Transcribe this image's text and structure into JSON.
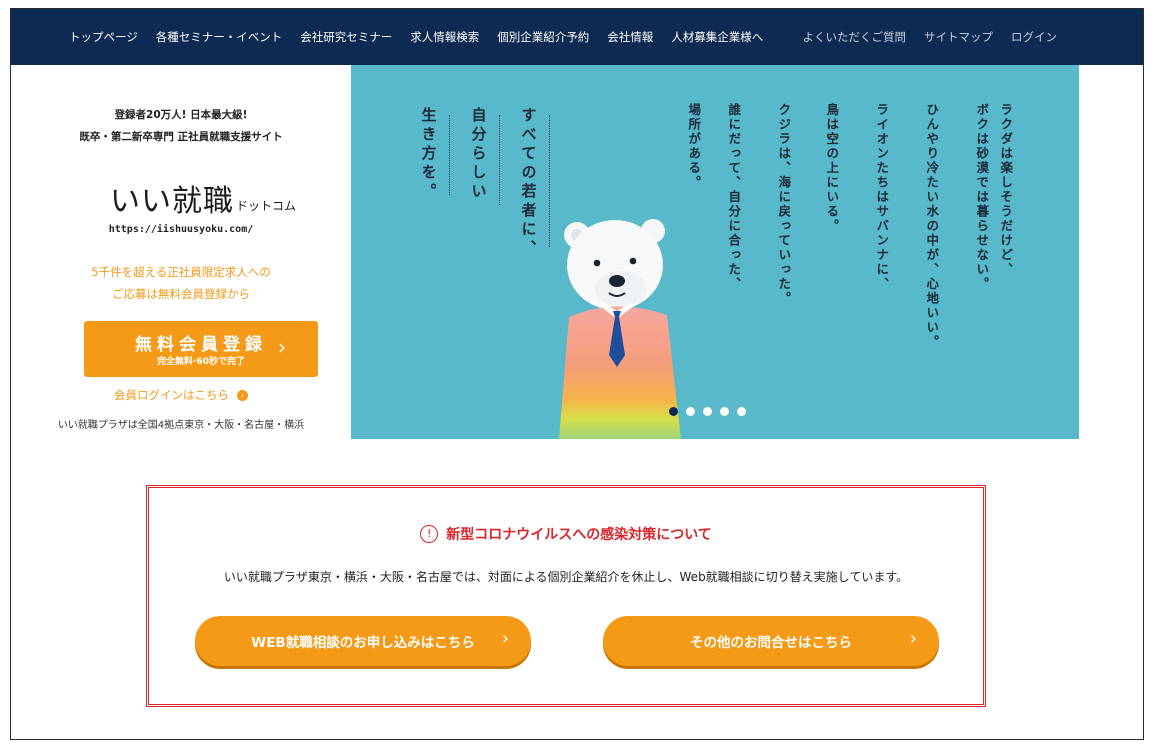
{
  "nav": {
    "left": [
      "トップページ",
      "各種セミナー・イベント",
      "会社研究セミナー",
      "求人情報検索",
      "個別企業紹介予約",
      "会社情報",
      "人材募集企業様へ"
    ],
    "right": [
      "よくいただくご質問",
      "サイトマップ",
      "ログイン"
    ]
  },
  "left": {
    "tagline1": "登録者20万人! 日本最大級!",
    "tagline2": "既卒・第二新卒専門 正社員就職支援サイト",
    "logo_main": "いい就職",
    "logo_sub": "ドットコム",
    "url": "https://iishuusyoku.com/",
    "promo1": "5千件を超える正社員限定求人への",
    "promo2": "ご応募は無料会員登録から",
    "register_main": "無料会員登録",
    "register_sub": "完全無料·60秒で完了",
    "login": "会員ログインはこちら",
    "plaza": "いい就職プラザは全国4拠点東京・大阪・名古屋・横浜"
  },
  "hero": {
    "columns": [
      "ラクダは楽しそうだけど、",
      "ボクは砂漠では暮らせない。",
      "ひんやり冷たい水の中が、心地いい。",
      "ライオンたちはサバンナに、",
      "鳥は空の上にいる。",
      "クジラは、海に戻っていった。",
      "誰にだって、自分に合った、",
      "場所がある。"
    ],
    "headline": [
      "すべての若者に、",
      "自分らしい",
      "生き方を。"
    ],
    "slides": 5,
    "active_slide": 1
  },
  "notice": {
    "title": "新型コロナウイルスへの感染対策について",
    "body": "いい就職プラザ東京・横浜・大阪・名古屋では、対面による個別企業紹介を休止し、Web就職相談に切り替え実施しています。",
    "btn_web": "WEB就職相談のお申し込みはこちら",
    "btn_other": "その他のお問合せはこちら"
  },
  "colors": {
    "nav_bg": "#0c2a52",
    "accent": "#f59a17",
    "hero_bg": "#57b9c9",
    "notice_red": "#d9262b"
  }
}
